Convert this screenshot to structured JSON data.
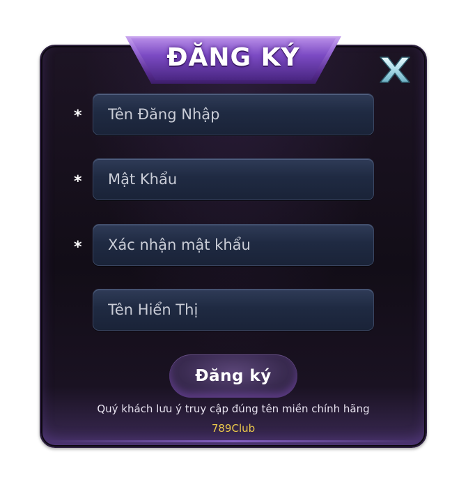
{
  "dialog": {
    "title": "ĐĂNG KÝ",
    "close_label": "X"
  },
  "form": {
    "required_mark": "*",
    "fields": [
      {
        "placeholder": "Tên Đăng Nhập",
        "required": true
      },
      {
        "placeholder": "Mật Khẩu",
        "required": true
      },
      {
        "placeholder": "Xác nhận mật khẩu",
        "required": true
      },
      {
        "placeholder": "Tên Hiển Thị",
        "required": false
      }
    ],
    "submit_label": "Đăng ký"
  },
  "footer": {
    "notice": "Quý khách lưu ý truy cập đúng tên miền chính hãng",
    "domain": "789Club"
  },
  "colors": {
    "panel_bg": "#120d17",
    "header_accent": "#7c4bc4",
    "field_bg": "#1f2a42",
    "domain_text": "#ecc94b",
    "close_icon": "#bfe9f2"
  }
}
